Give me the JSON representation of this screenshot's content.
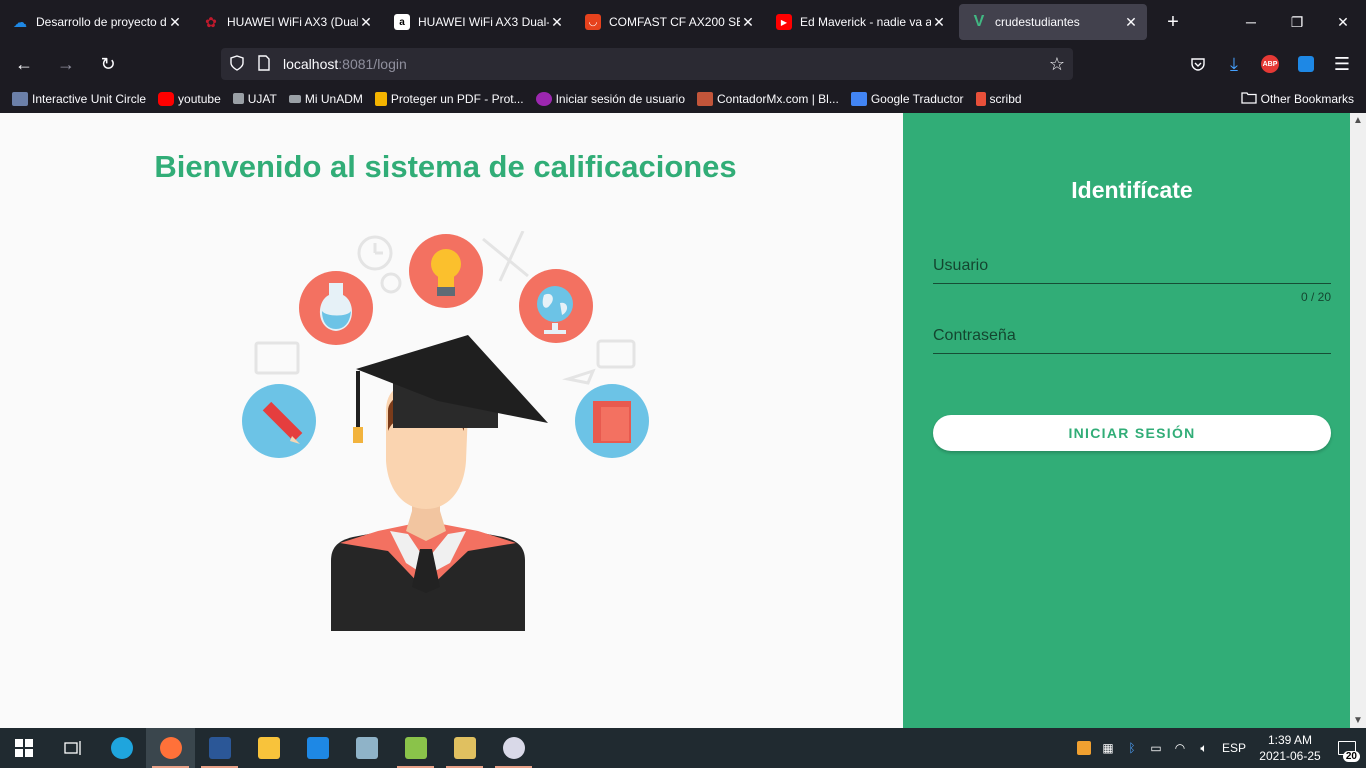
{
  "browser": {
    "tabs": [
      {
        "title": "Desarrollo de proyecto de",
        "icon": "onedrive-icon",
        "color": "#1e88e5",
        "active": false
      },
      {
        "title": "HUAWEI WiFi AX3 (Dual-C",
        "icon": "huawei-icon",
        "color": "#c0192c",
        "active": false
      },
      {
        "title": "HUAWEI WiFi AX3 Dual-C",
        "icon": "amazon-icon",
        "color": "#ffffff",
        "active": false
      },
      {
        "title": "COMFAST CF AX200 SE 30",
        "icon": "aliexpress-icon",
        "color": "#e6421d",
        "active": false
      },
      {
        "title": "Ed Maverick - nadie va a p",
        "icon": "youtube-icon",
        "color": "#ff0000",
        "active": false
      },
      {
        "title": "crudestudiantes",
        "icon": "vue-icon",
        "color": "#41b883",
        "active": true
      }
    ],
    "url_host": "localhost",
    "url_path": ":8081/login",
    "bookmarks": [
      {
        "label": "Interactive Unit Circle",
        "color": "#6b7fa8"
      },
      {
        "label": "youtube",
        "color": "#ff0000"
      },
      {
        "label": "UJAT",
        "color": "#9aa0a6"
      },
      {
        "label": "Mi UnADM",
        "color": "#9aa0a6"
      },
      {
        "label": "Proteger un PDF - Prot...",
        "color": "#f4b400"
      },
      {
        "label": "Iniciar sesión de usuario",
        "color": "#9c27b0"
      },
      {
        "label": "ContadorMx.com | Bl...",
        "color": "#c2553a"
      },
      {
        "label": "Google Traductor",
        "color": "#4285f4"
      },
      {
        "label": "scribd",
        "color": "#e8503a"
      }
    ],
    "other_bookmarks": "Other Bookmarks"
  },
  "page": {
    "welcome_title": "Bienvenido al sistema de calificaciones",
    "login_title": "Identifícate",
    "username_label": "Usuario",
    "username_counter": "0 / 20",
    "password_label": "Contraseña",
    "login_button": "INICIAR SESIÓN",
    "accent_color": "#31ad77"
  },
  "taskbar": {
    "language": "ESP",
    "time": "1:39 AM",
    "date": "2021-06-25",
    "notifications": "20"
  }
}
